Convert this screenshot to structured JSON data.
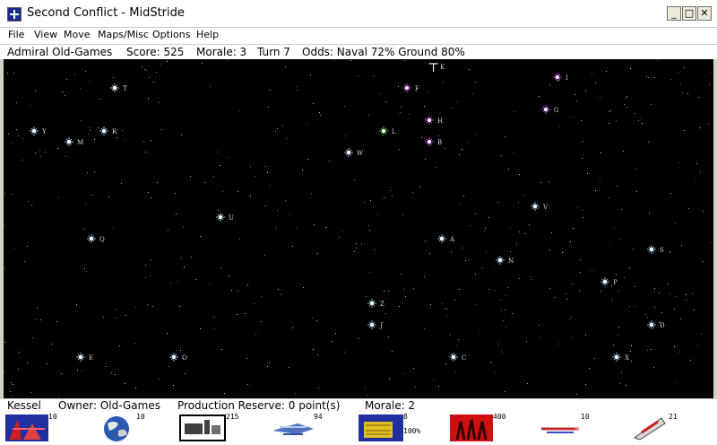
{
  "window": {
    "title": "Second Conflict - MidStride",
    "minimize": "_",
    "maximize": "□",
    "close": "✕"
  },
  "menu": [
    "File",
    "View",
    "Move",
    "Maps/Misc",
    "Options",
    "Help"
  ],
  "status": {
    "player": "Admiral Old-Games",
    "score": "Score: 525",
    "morale": "Morale: 3",
    "turn": "Turn 7",
    "odds": "Odds: Naval 72% Ground 80%"
  },
  "stars": [
    {
      "label": "T",
      "owner": "neutral"
    },
    {
      "label": "F",
      "owner": "enemy"
    },
    {
      "label": "K",
      "owner": "none"
    },
    {
      "label": "I",
      "owner": "enemy"
    },
    {
      "label": "H",
      "owner": "enemy"
    },
    {
      "label": "G",
      "owner": "enemy"
    },
    {
      "label": "Y",
      "owner": "neutral"
    },
    {
      "label": "R",
      "owner": "neutral"
    },
    {
      "label": "M",
      "owner": "neutral"
    },
    {
      "label": "L",
      "owner": "player"
    },
    {
      "label": "B",
      "owner": "enemy"
    },
    {
      "label": "W",
      "owner": "neutral"
    },
    {
      "label": "V",
      "owner": "neutral"
    },
    {
      "label": "U",
      "owner": "neutral"
    },
    {
      "label": "Q",
      "owner": "neutral"
    },
    {
      "label": "A",
      "owner": "neutral"
    },
    {
      "label": "S",
      "owner": "neutral"
    },
    {
      "label": "N",
      "owner": "neutral"
    },
    {
      "label": "P",
      "owner": "neutral"
    },
    {
      "label": "Z",
      "owner": "neutral"
    },
    {
      "label": "J",
      "owner": "neutral"
    },
    {
      "label": "D",
      "owner": "neutral"
    },
    {
      "label": "E",
      "owner": "neutral"
    },
    {
      "label": "O",
      "owner": "neutral"
    },
    {
      "label": "C",
      "owner": "neutral"
    },
    {
      "label": "X",
      "owner": "neutral"
    }
  ],
  "owner_colors": {
    "neutral": "#8ab8d8",
    "enemy": "#c040e0",
    "player": "#40d040",
    "none": "#ffffff"
  },
  "selected": {
    "system": "Kessel",
    "owner": "Owner: Old-Games",
    "reserve": "Production Reserve: 0 point(s)",
    "morale": "Morale: 2"
  },
  "units": [
    {
      "name": "warships-icon",
      "count": "10"
    },
    {
      "name": "planet-icon",
      "count": "10"
    },
    {
      "name": "factories-icon",
      "count": "215"
    },
    {
      "name": "transports-icon",
      "count": "94"
    },
    {
      "name": "stealthships-icon",
      "count": "8",
      "extra": "100%"
    },
    {
      "name": "troopships-icon",
      "count": "400"
    },
    {
      "name": "missiles-icon",
      "count": "10"
    },
    {
      "name": "scouts-icon",
      "count": "21"
    }
  ]
}
